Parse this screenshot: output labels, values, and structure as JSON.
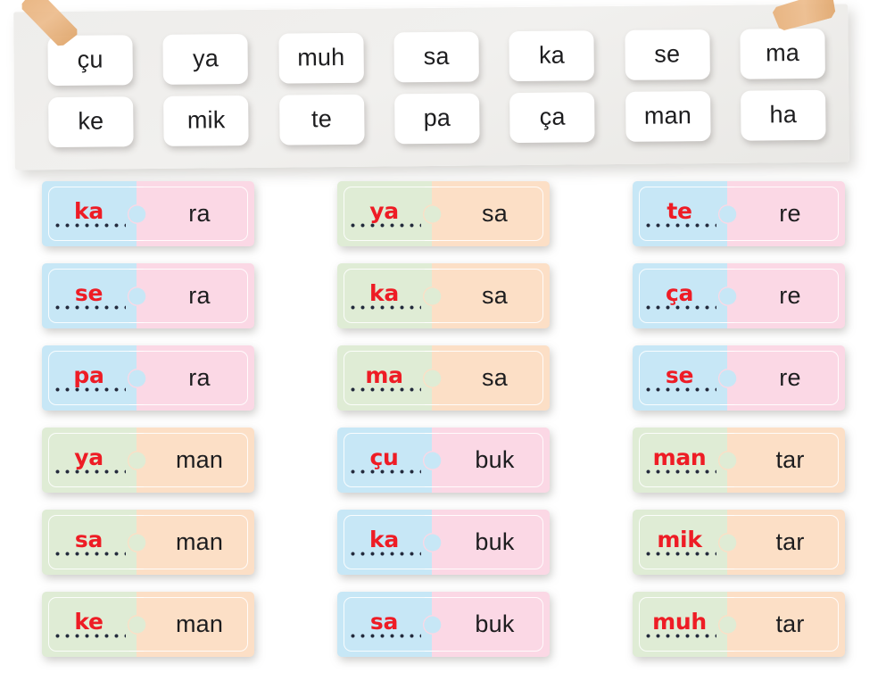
{
  "colors": {
    "blue": "#c7e7f6",
    "pink": "#fbd8e5",
    "green": "#dfecd5",
    "peach": "#fcdfc6",
    "answer_red": "#ee1c25",
    "text_dark": "#1d1d1f",
    "panel_gray": "#eeedeb",
    "tape_tan": "#e7b079"
  },
  "syllable_bank": {
    "row1": [
      "çu",
      "ya",
      "muh",
      "sa",
      "ka",
      "se",
      "ma"
    ],
    "row2": [
      "ke",
      "mik",
      "te",
      "pa",
      "ça",
      "man",
      "ha"
    ]
  },
  "puzzles": [
    {
      "answer": "ka",
      "suffix": "ra",
      "left_color": "blue",
      "right_color": "pink"
    },
    {
      "answer": "ya",
      "suffix": "sa",
      "left_color": "green",
      "right_color": "peach"
    },
    {
      "answer": "te",
      "suffix": "re",
      "left_color": "blue",
      "right_color": "pink"
    },
    {
      "answer": "se",
      "suffix": "ra",
      "left_color": "blue",
      "right_color": "pink"
    },
    {
      "answer": "ka",
      "suffix": "sa",
      "left_color": "green",
      "right_color": "peach"
    },
    {
      "answer": "ça",
      "suffix": "re",
      "left_color": "blue",
      "right_color": "pink"
    },
    {
      "answer": "pa",
      "suffix": "ra",
      "left_color": "blue",
      "right_color": "pink"
    },
    {
      "answer": "ma",
      "suffix": "sa",
      "left_color": "green",
      "right_color": "peach"
    },
    {
      "answer": "se",
      "suffix": "re",
      "left_color": "blue",
      "right_color": "pink"
    },
    {
      "answer": "ya",
      "suffix": "man",
      "left_color": "green",
      "right_color": "peach"
    },
    {
      "answer": "çu",
      "suffix": "buk",
      "left_color": "blue",
      "right_color": "pink"
    },
    {
      "answer": "man",
      "suffix": "tar",
      "left_color": "green",
      "right_color": "peach"
    },
    {
      "answer": "sa",
      "suffix": "man",
      "left_color": "green",
      "right_color": "peach"
    },
    {
      "answer": "ka",
      "suffix": "buk",
      "left_color": "blue",
      "right_color": "pink"
    },
    {
      "answer": "mik",
      "suffix": "tar",
      "left_color": "green",
      "right_color": "peach"
    },
    {
      "answer": "ke",
      "suffix": "man",
      "left_color": "green",
      "right_color": "peach"
    },
    {
      "answer": "sa",
      "suffix": "buk",
      "left_color": "blue",
      "right_color": "pink"
    },
    {
      "answer": "muh",
      "suffix": "tar",
      "left_color": "green",
      "right_color": "peach"
    }
  ]
}
